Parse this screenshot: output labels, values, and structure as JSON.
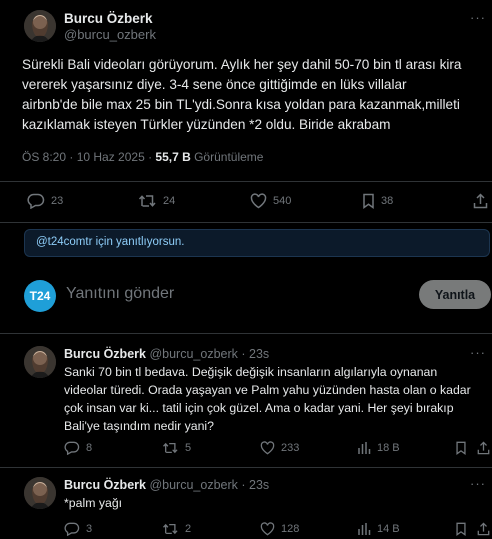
{
  "main_tweet": {
    "author_name": "Burcu Özberk",
    "author_handle": "@burcu_ozberk",
    "text_lines": [
      "Sürekli Bali videoları görüyorum. Aylık her şey dahil 50-70 bin tl arası kira",
      "vererek yaşarsınız diye. 3-4 sene önce gittiğimde en lüks villalar",
      "airbnb'de bile max 25 bin TL'ydi.Sonra kısa yoldan para kazanmak,milleti",
      "kazıklamak isteyen Türkler  yüzünden *2 oldu. Biride  akrabam"
    ],
    "timestamp": "ÖS 8:20 · 10 Haz 2025 · ",
    "views_count": "55,7 B",
    "views_label": " Görüntüleme",
    "replies": "23",
    "reposts": "24",
    "likes": "540",
    "bookmarks": "38"
  },
  "reply_context": {
    "text": "@t24comtr için yanıtlıyorsun."
  },
  "composer": {
    "avatar_text": "T24",
    "placeholder": "Yanıtını gönder",
    "submit_label": "Yanıtla"
  },
  "replies": [
    {
      "author_name": "Burcu Özberk",
      "author_handle": "@burcu_ozberk",
      "time": "· 23s",
      "text_lines": [
        "Sanki 70 bin tl bedava. Değişik değişik insanların algılarıyla oynanan",
        "videolar türedi. Orada yaşayan ve Palm yahu yüzünden hasta olan o kadar",
        "çok insan var ki... tatil için çok güzel. Ama o kadar yani. Her şeyi bırakıp",
        "Bali'ye taşındım nedir yani?"
      ],
      "replies": "8",
      "reposts": "5",
      "likes": "233",
      "views": "18 B"
    },
    {
      "author_name": "Burcu Özberk",
      "author_handle": "@burcu_ozberk",
      "time": "· 23s",
      "text_lines": [
        "*palm yağı"
      ],
      "replies": "3",
      "reposts": "2",
      "likes": "128",
      "views": "14 B"
    }
  ],
  "colors": {
    "background": "#000000",
    "text": "#e7e9ea",
    "muted": "#71767b",
    "divider": "#2f3336",
    "t24_blue": "#1f9fd8",
    "reply_context_text": "#8ecdf8"
  }
}
